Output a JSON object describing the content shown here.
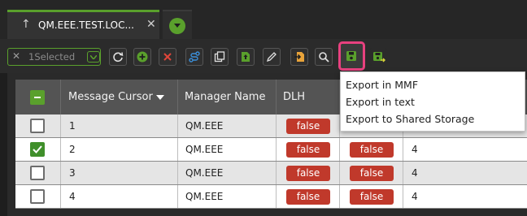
{
  "tabs": [
    {
      "label": "QM.EEE.TEST.LOC...",
      "icon": "pin-arrow-icon",
      "close_icon": "close-icon"
    }
  ],
  "tab_add_icon": "chevron-down-circle-icon",
  "toolbar": {
    "selection_label": "1Selected",
    "selection_clear_icon": "close-icon",
    "selection_dropdown_icon": "chevron-down-icon",
    "buttons": [
      {
        "icon": "refresh-icon"
      },
      {
        "icon": "add-icon"
      },
      {
        "icon": "delete-icon"
      },
      {
        "icon": "route-icon"
      },
      {
        "icon": "copy-icon"
      },
      {
        "icon": "upload-icon"
      },
      {
        "icon": "edit-icon"
      },
      {
        "icon": "import-icon"
      },
      {
        "icon": "search-icon"
      },
      {
        "icon": "save-icon",
        "highlighted": true
      },
      {
        "icon": "save-export-icon"
      }
    ]
  },
  "colors": {
    "accent": "#5aa02c",
    "highlight": "#e8417f",
    "badge": "#c0392b"
  },
  "table": {
    "columns": [
      "",
      "Message Cursor",
      "Manager Name",
      "DLH",
      "",
      ""
    ],
    "sort_icon": "sort-desc-icon",
    "rows": [
      {
        "checked": false,
        "cursor": "1",
        "manager": "QM.EEE",
        "dlh": "false",
        "col5": "",
        "col6": ""
      },
      {
        "checked": true,
        "cursor": "2",
        "manager": "QM.EEE",
        "dlh": "false",
        "col5": "false",
        "col6": "4"
      },
      {
        "checked": false,
        "cursor": "3",
        "manager": "QM.EEE",
        "dlh": "false",
        "col5": "false",
        "col6": "4"
      },
      {
        "checked": false,
        "cursor": "4",
        "manager": "QM.EEE",
        "dlh": "false",
        "col5": "false",
        "col6": "4"
      }
    ]
  },
  "export_menu": {
    "items": [
      "Export in MMF",
      "Export in text",
      "Export to Shared Storage"
    ]
  }
}
